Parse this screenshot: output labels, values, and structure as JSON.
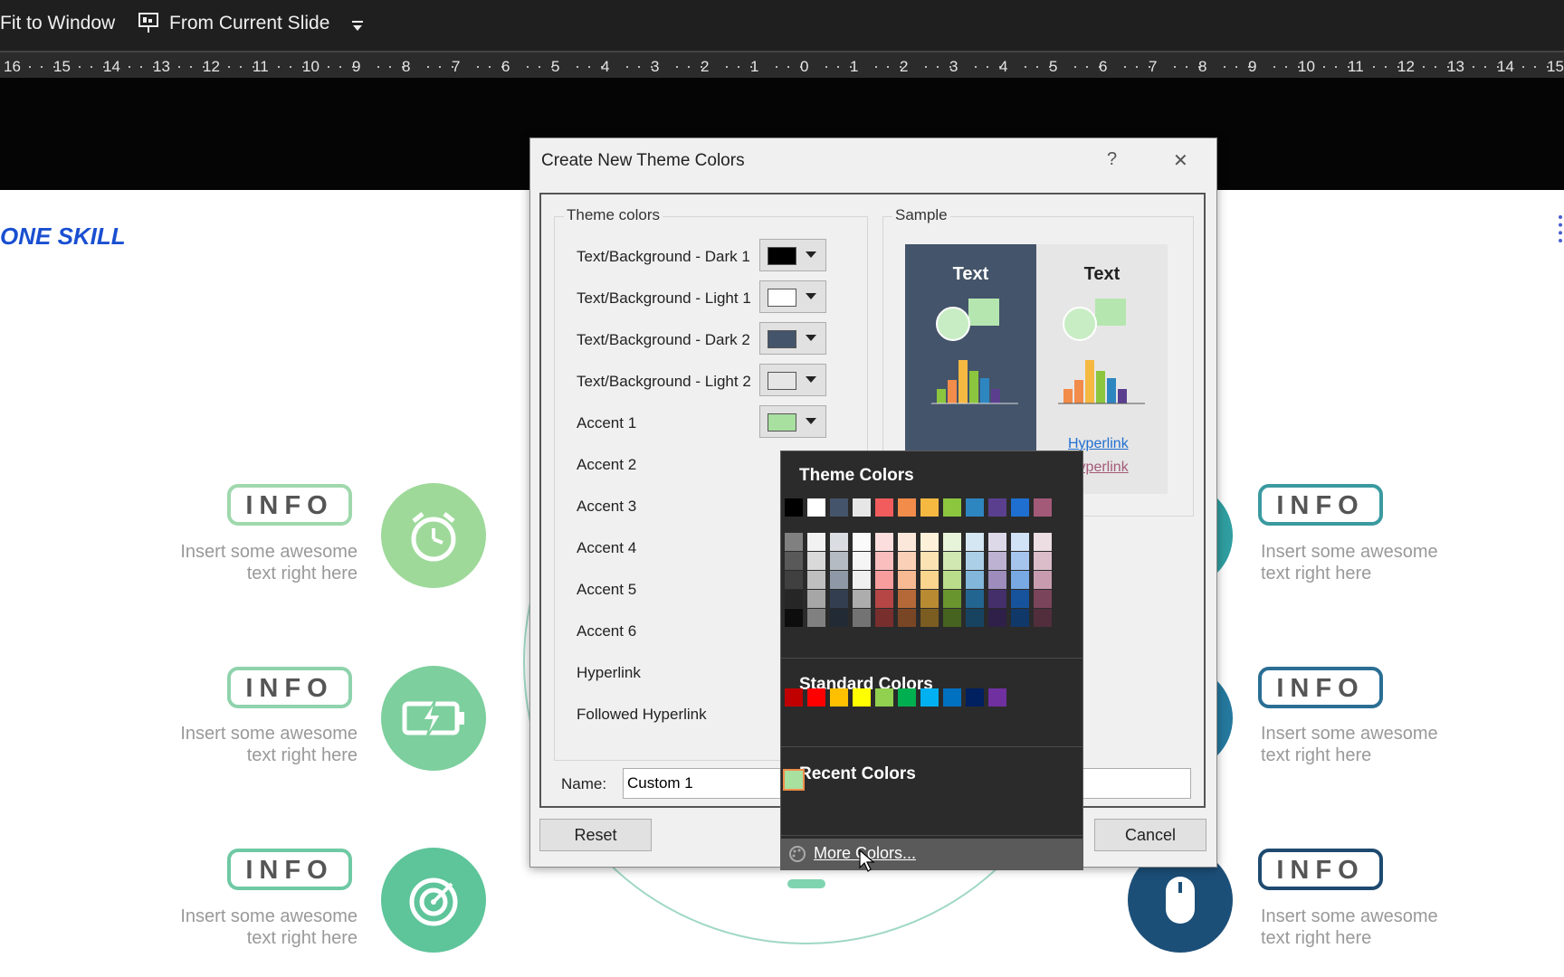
{
  "toolbar": {
    "fit_label": "Fit to Window",
    "from_slide_label": "From Current Slide"
  },
  "ruler": [
    "16",
    "15",
    "14",
    "13",
    "12",
    "11",
    "10",
    "9",
    "8",
    "7",
    "6",
    "5",
    "4",
    "3",
    "2",
    "1",
    "0",
    "1",
    "2",
    "3",
    "4",
    "5",
    "6",
    "7",
    "8",
    "9",
    "10",
    "11",
    "12",
    "13",
    "14",
    "15"
  ],
  "slide": {
    "logo": "ONE SKILL",
    "info_label": "INFO",
    "info_text_line1": "Insert some awesome",
    "info_text_line2": "text right here"
  },
  "dialog": {
    "title": "Create New Theme Colors",
    "help": "?",
    "close": "✕",
    "theme_colors_label": "Theme colors",
    "sample_label": "Sample",
    "rows": [
      {
        "label": "Text/Background - Dark 1",
        "color": "#000000"
      },
      {
        "label": "Text/Background - Light 1",
        "color": "#ffffff"
      },
      {
        "label": "Text/Background - Dark 2",
        "color": "#44546a"
      },
      {
        "label": "Text/Background - Light 2",
        "color": "#e7e6e6"
      },
      {
        "label": "Accent 1",
        "color": "#a8e0a0"
      },
      {
        "label": "Accent 2"
      },
      {
        "label": "Accent 3"
      },
      {
        "label": "Accent 4"
      },
      {
        "label": "Accent 5"
      },
      {
        "label": "Accent 6"
      },
      {
        "label": "Hyperlink"
      },
      {
        "label": "Followed Hyperlink"
      }
    ],
    "sample": {
      "text": "Text",
      "hyperlink": "Hyperlink",
      "followed": "Hyperlink"
    },
    "name_label": "Name:",
    "name_value": "Custom 1",
    "reset_label": "Reset",
    "cancel_label": "Cancel"
  },
  "picker": {
    "theme_heading": "Theme Colors",
    "standard_heading": "Standard Colors",
    "recent_heading": "Recent Colors",
    "more_colors": "More Colors...",
    "theme_top": [
      "#000000",
      "#ffffff",
      "#44546a",
      "#e7e6e6",
      "#f25c5c",
      "#f28c4a",
      "#f5b942",
      "#8cc63f",
      "#2e86c1",
      "#5b3f8f",
      "#1f6fd1",
      "#a35a78"
    ],
    "standard": [
      "#c00000",
      "#ff0000",
      "#ffc000",
      "#ffff00",
      "#92d050",
      "#00b050",
      "#00b0f0",
      "#0070c0",
      "#002060",
      "#7030a0"
    ],
    "recent": [
      "#a8e0a0"
    ]
  }
}
